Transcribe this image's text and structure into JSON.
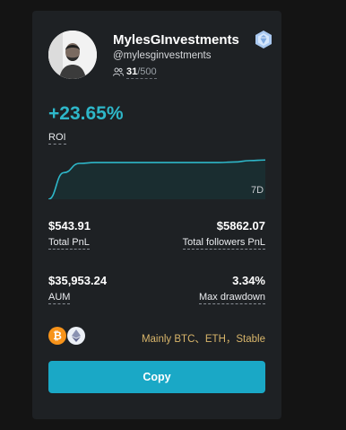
{
  "trader": {
    "name": "MylesGInvestments",
    "handle": "@mylesginvestments",
    "followers_current": "31",
    "followers_max": "/500"
  },
  "roi": {
    "value": "+23.65%",
    "label": "ROI",
    "period": "7D"
  },
  "chart_data": {
    "type": "area",
    "x": [
      0,
      1,
      2,
      3,
      4,
      5,
      6,
      7,
      8,
      9,
      10,
      11,
      12,
      13,
      14
    ],
    "values": [
      0,
      9.5,
      12.8,
      13.1,
      13.1,
      13.1,
      13.1,
      13.1,
      13.1,
      13.1,
      13.1,
      13.1,
      13.3,
      13.8,
      14.0
    ],
    "ylim": [
      0,
      16
    ],
    "line_color": "#2eb7c9",
    "fill_color": "#1a2d30"
  },
  "stats": {
    "total_pnl": {
      "value": "$543.91",
      "label": "Total PnL"
    },
    "total_followers_pnl": {
      "value": "$5862.07",
      "label": "Total followers PnL"
    },
    "aum": {
      "value": "$35,953.24",
      "label": "AUM"
    },
    "max_drawdown": {
      "value": "3.34%",
      "label": "Max drawdown"
    }
  },
  "assets": {
    "icons": [
      "bitcoin-icon",
      "ethereum-icon"
    ],
    "btc_symbol": "₿",
    "text": "Mainly BTC、ETH，Stable"
  },
  "actions": {
    "copy_label": "Copy"
  },
  "colors": {
    "background": "#141414",
    "card": "#1e2124",
    "accent": "#2eb7c9",
    "button": "#1aa8c6",
    "asset_text": "#d8b56a"
  }
}
